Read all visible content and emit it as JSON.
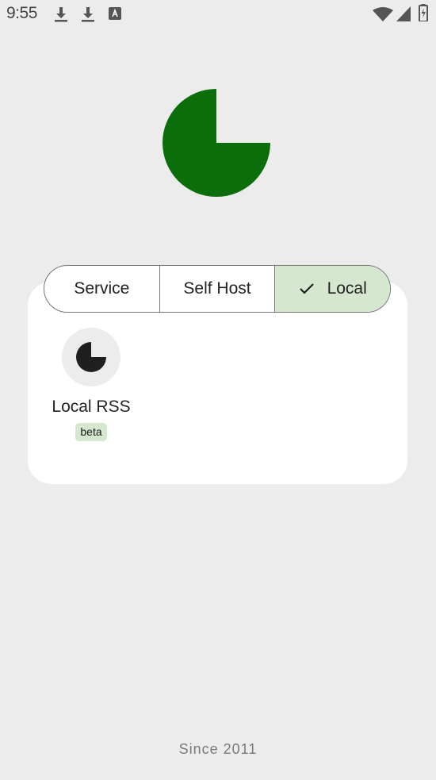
{
  "status_bar": {
    "time": "9:55",
    "left_icons": [
      "download-icon",
      "download-icon",
      "font-app-icon"
    ],
    "right_icons": [
      "wifi-icon",
      "signal-icon",
      "battery-charging-icon"
    ]
  },
  "logo": {
    "icon": "pie-logo-icon",
    "color": "#0b6e0b"
  },
  "segmented": {
    "options": [
      {
        "label": "Service",
        "selected": false
      },
      {
        "label": "Self Host",
        "selected": false
      },
      {
        "label": "Local",
        "selected": true
      }
    ],
    "selected_color": "#d5e8cf"
  },
  "items": [
    {
      "icon": "pie-logo-icon",
      "label": "Local RSS",
      "badge": "beta"
    }
  ],
  "footer": {
    "text": "Since 2011"
  }
}
